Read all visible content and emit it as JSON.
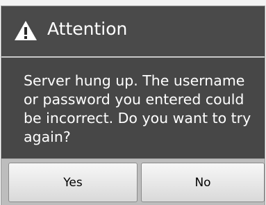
{
  "dialog": {
    "title": "Attention",
    "icon": "warning-icon",
    "message": "Server hung up. The username or password you entered could be incorrect. Do you want to try again?",
    "buttons": {
      "yes_label": "Yes",
      "no_label": "No"
    }
  }
}
